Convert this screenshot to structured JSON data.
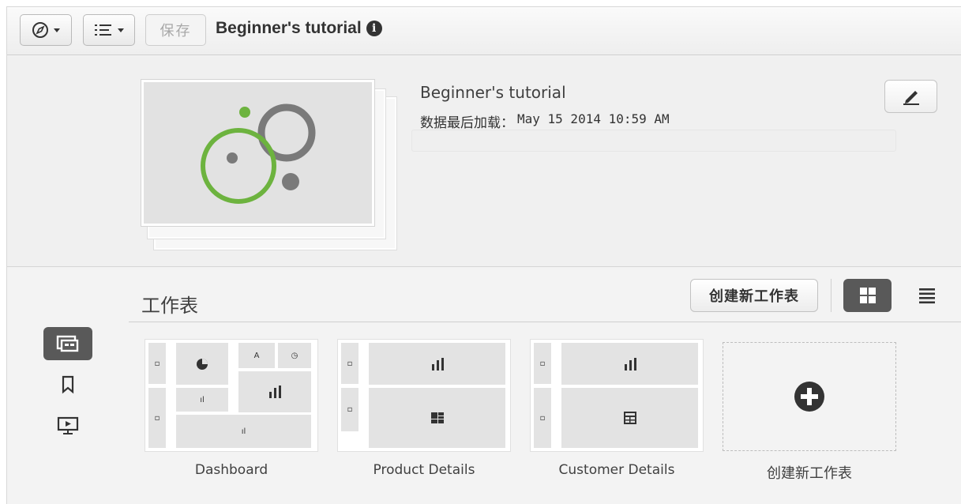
{
  "toolbar": {
    "save_label": "保存",
    "app_title": "Beginner's tutorial",
    "info_icon": "info-icon",
    "nav_icon": "compass-icon",
    "menu_icon": "list-menu-icon"
  },
  "header": {
    "app_name": "Beginner's tutorial",
    "reload_label": "数据最后加载：",
    "reload_value": "May 15 2014 10:59 AM",
    "edit_icon": "pencil-icon"
  },
  "sheets": {
    "title": "工作表",
    "create_button": "创建新工作表",
    "items": [
      {
        "label": "Dashboard"
      },
      {
        "label": "Product Details"
      },
      {
        "label": "Customer Details"
      }
    ],
    "new_sheet_label": "创建新工作表"
  },
  "side_nav": {
    "items": [
      "sheets-icon",
      "bookmark-icon",
      "story-icon"
    ]
  },
  "colors": {
    "accent_green": "#6db33f",
    "dark_gray": "#595959",
    "circle_gray": "#7a7a7a"
  }
}
